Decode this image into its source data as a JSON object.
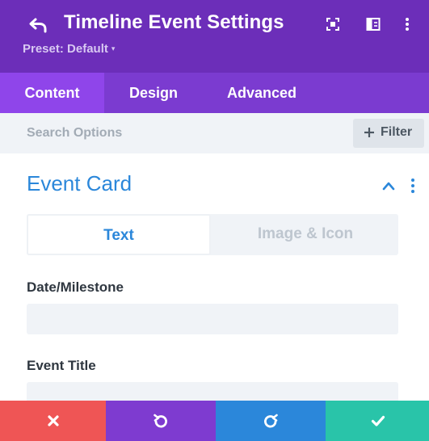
{
  "header": {
    "back_icon": "undo-arrow-icon",
    "title": "Timeline Event Settings",
    "preset_label": "Preset: Default",
    "preset_caret": "▾",
    "icons": [
      "fullscreen-icon",
      "sidebar-layout-icon",
      "more-vertical-icon"
    ],
    "background_color": "#6c2eb9"
  },
  "tabs": [
    {
      "label": "Content",
      "active": true
    },
    {
      "label": "Design",
      "active": false
    },
    {
      "label": "Advanced",
      "active": false
    }
  ],
  "search": {
    "placeholder": "Search Options",
    "value": "",
    "filter_label": "Filter",
    "filter_icon": "plus-icon"
  },
  "section": {
    "title": "Event Card",
    "expanded": true,
    "toggle_icon": "chevron-up-icon",
    "more_icon": "more-vertical-icon",
    "subtabs": [
      {
        "label": "Text",
        "active": true
      },
      {
        "label": "Image & Icon",
        "active": false
      }
    ],
    "fields": [
      {
        "label": "Date/Milestone",
        "value": ""
      },
      {
        "label": "Event Title",
        "value": ""
      }
    ]
  },
  "footer": {
    "buttons": [
      {
        "action": "close",
        "icon": "close-icon",
        "color": "#ef5555"
      },
      {
        "action": "undo",
        "icon": "undo-icon",
        "color": "#7e3bd0"
      },
      {
        "action": "redo",
        "icon": "redo-icon",
        "color": "#2b87da"
      },
      {
        "action": "save",
        "icon": "check-icon",
        "color": "#29c4a9"
      }
    ]
  },
  "colors": {
    "accent_blue": "#2b87da",
    "tab_active": "#8f45ea",
    "tab_bar": "#7b3bd0",
    "panel_bg": "#f0f3f7"
  }
}
